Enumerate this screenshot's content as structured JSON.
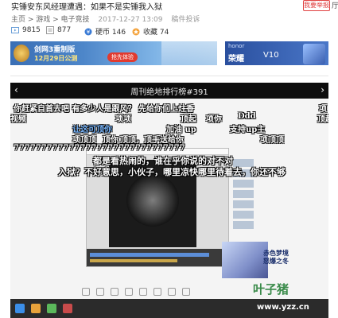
{
  "header": {
    "title": "实锤安东风经理遭遇：如果不是实锤我入狱",
    "report_label": "我要举报",
    "cut_char": "厅"
  },
  "meta": {
    "category": "主页 > 游戏 > 电子竞技",
    "date": "2017-12-27 13:09",
    "rights": "稿件投诉"
  },
  "stats": {
    "views": "9815",
    "danmaku": "877",
    "coins_label": "硬币 146",
    "favorites_label": "收藏 74"
  },
  "ads": {
    "ad1": {
      "line1": "剑网3重制版",
      "line2": "12月29日公测",
      "button": "抢先体验"
    },
    "ad2": {
      "brand": "honor",
      "line1": "荣耀",
      "line2": "V10"
    }
  },
  "player": {
    "title": "周刊绝地排行榜#391",
    "prev": "‹",
    "next": "›",
    "poster_text": "赤色梦境\n怒爆之冬",
    "watermark": "叶子猪",
    "watermark_url": "www.yzz.cn"
  },
  "danmaku": [
    {
      "text": "你赶紧自首去吧    有多少人是跟风？   先给你们上炷香",
      "color": "#ffffff"
    },
    {
      "text": "项",
      "color": "#ffffff"
    },
    {
      "text": "视频",
      "color": "#ffffff"
    },
    {
      "text": "项项",
      "color": "#ffffff"
    },
    {
      "text": "顶起",
      "color": "#ffffff"
    },
    {
      "text": "项你",
      "color": "#ffffff"
    },
    {
      "text": "Ddd",
      "color": "#ffffff"
    },
    {
      "text": "顶起",
      "color": "#ffffff"
    },
    {
      "text": "让这可顶你",
      "color": "#7ab8ff"
    },
    {
      "text": "加油 up",
      "color": "#ffffff"
    },
    {
      "text": "支持up主",
      "color": "#ffffff"
    },
    {
      "text": "项顶顶",
      "color": "#ffffff"
    },
    {
      "text": "顶你",
      "color": "#ffffff"
    },
    {
      "text": "顶顶，顶手送给你",
      "color": "#ffffff"
    },
    {
      "text": "项顶顶",
      "color": "#ffffff"
    },
    {
      "text": "7777777777777777777777777777777",
      "color": "#ffffff"
    },
    {
      "text": "都是看热闹的，谁在乎你说的对不对",
      "color": "#ffffff"
    },
    {
      "text": "入狱？不好意思，小伙子，哪里凉快哪里待着去，你还不够",
      "color": "#ffffff"
    }
  ]
}
